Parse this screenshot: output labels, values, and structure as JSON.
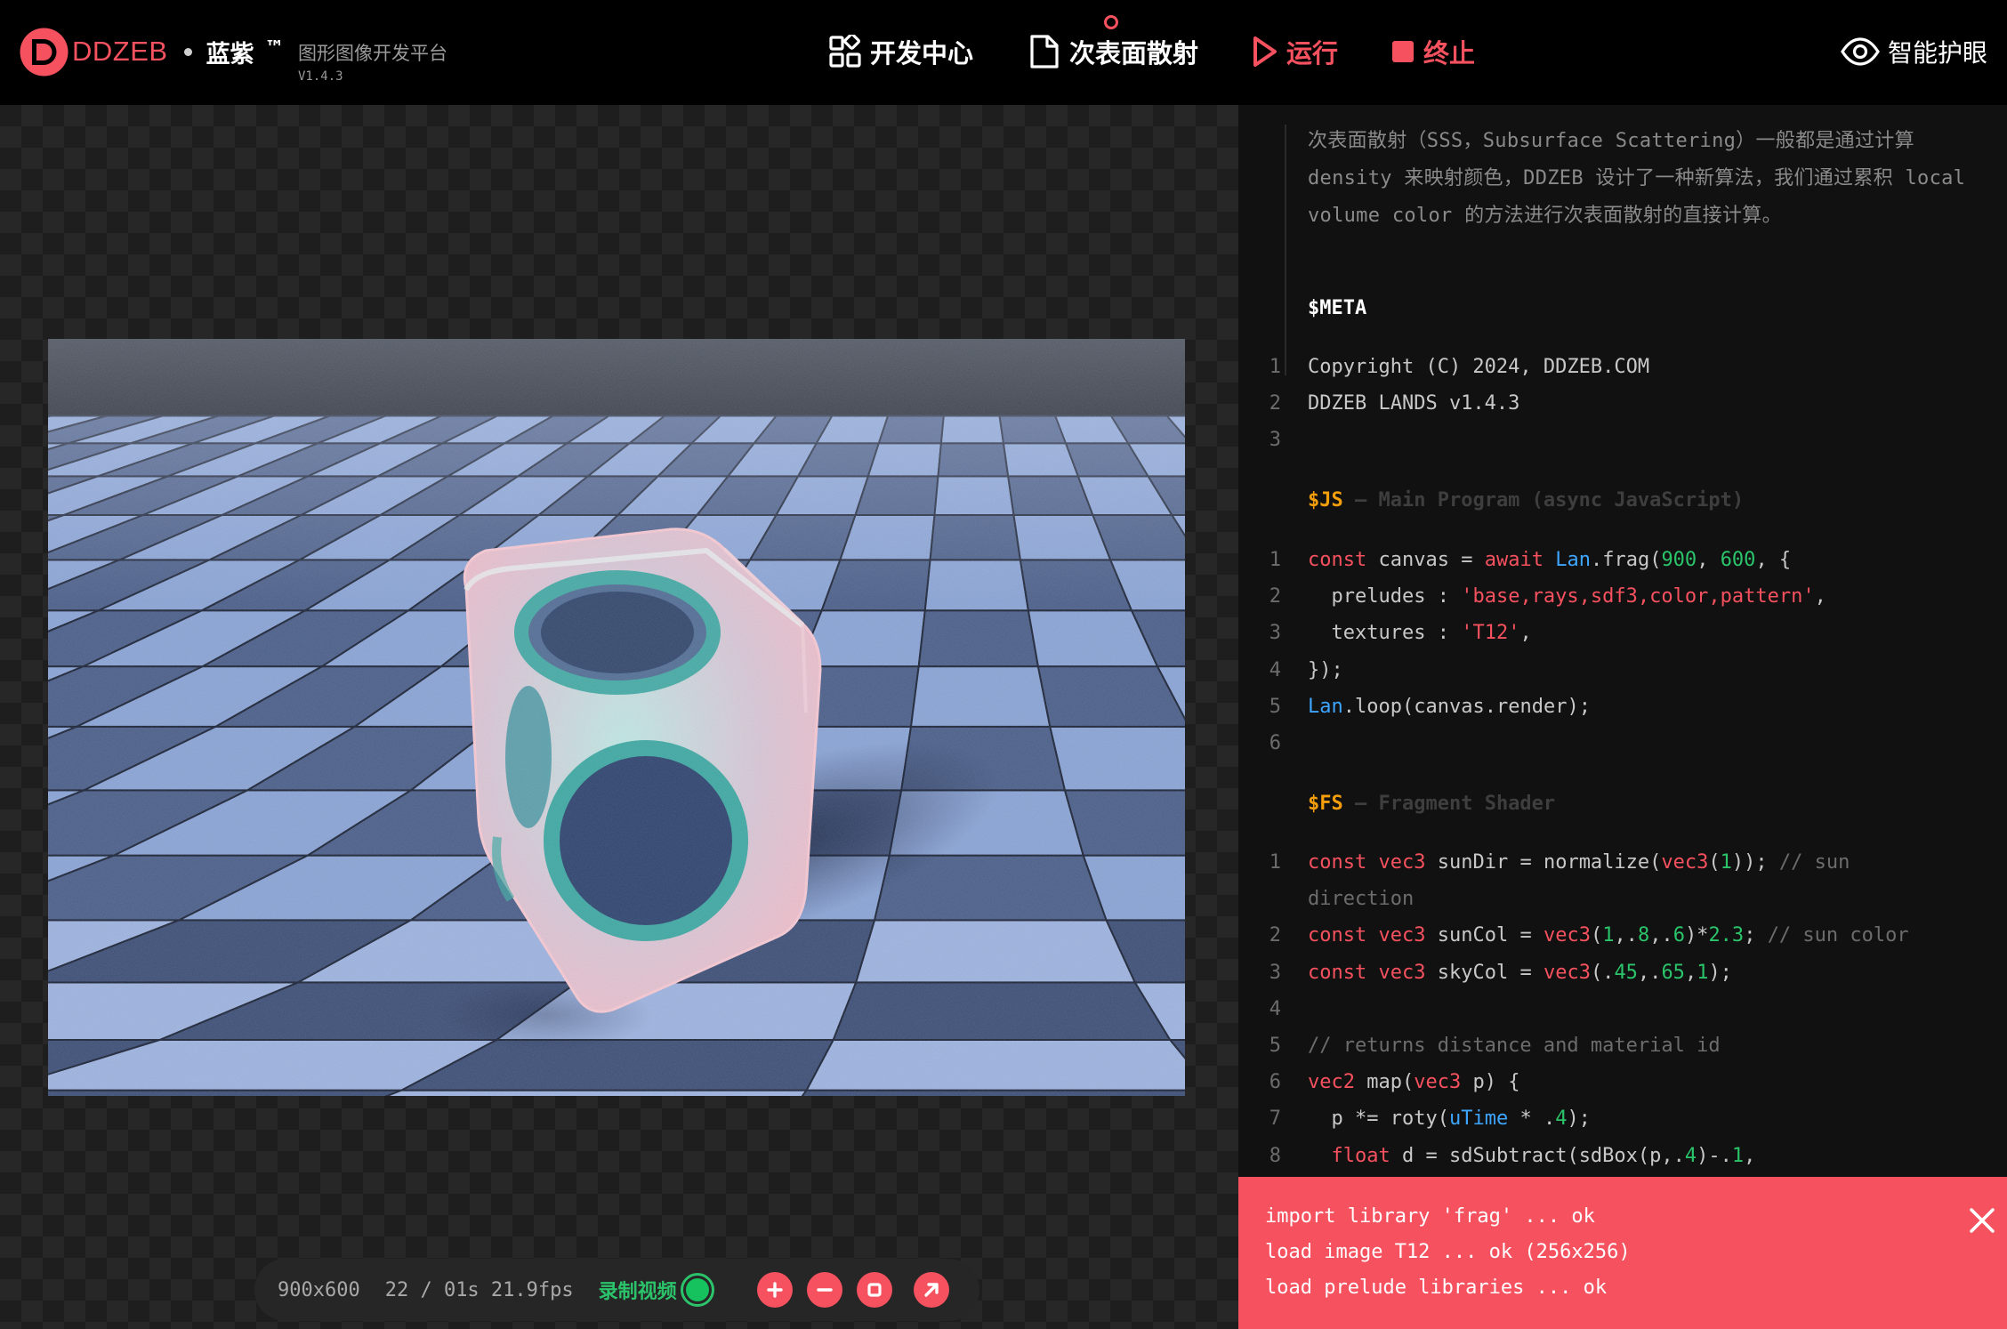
{
  "brand": {
    "name": "DDZEB",
    "cn_name": "蓝紫",
    "tm": "™",
    "subtitle": "图形图像开发平台",
    "version": "V1.4.3"
  },
  "nav": {
    "dev_center": "开发中心",
    "file_name": "次表面散射",
    "run": "运行",
    "stop": "终止",
    "eye_care": "智能护眼"
  },
  "colors": {
    "accent": "#f5515f",
    "green": "#2bc46b",
    "code_keyword": "#f5515f",
    "code_builtin": "#3ea6ff",
    "code_number": "#2bc46b",
    "section_tag": "#f59e0b"
  },
  "intro": {
    "lines": [
      "次表面散射（SSS，Subsurface Scattering）一般都是通过计算",
      "density 来映射颜色，DDZEB 设计了一种新算法，我们通过累积 local",
      "volume color 的方法进行次表面散射的直接计算。"
    ]
  },
  "meta": {
    "title": "$META",
    "lines": [
      "Copyright (C) 2024, DDZEB.COM",
      "DDZEB LANDS v1.4.3",
      ""
    ]
  },
  "js": {
    "tag": "$JS",
    "desc": "— Main Program (async JavaScript)",
    "lines": [
      "const canvas = await Lan.frag(900, 600, {",
      "  preludes : 'base,rays,sdf3,color,pattern',",
      "  textures : 'T12',",
      "});",
      "Lan.loop(canvas.render);",
      ""
    ]
  },
  "fs": {
    "tag": "$FS",
    "desc": "— Fragment Shader",
    "lines": [
      "const vec3 sunDir = normalize(vec3(1)); // sun",
      "direction",
      "const vec3 sunCol = vec3(1,.8,.6)*2.3; // sun color",
      "const vec3 skyCol = vec3(.45,.65,1);",
      "",
      "// returns distance and material id",
      "vec2 map(vec3 p) {",
      "  p *= roty(uTime * .4);",
      "  float d = sdSubtract(sdBox(p,.4)-.1,"
    ],
    "line_numbers": [
      "1",
      "",
      "2",
      "3",
      "4",
      "5",
      "6",
      "7",
      "8"
    ]
  },
  "status": {
    "resolution": "900x600",
    "frame": "22 / 01s 21.9fps",
    "record_label": "录制视频"
  },
  "console": {
    "lines": [
      "import library 'frag' ... ok",
      "load image T12 ... ok (256x256)",
      "load prelude libraries ... ok"
    ]
  },
  "icons": {
    "dev_center": "grid-icon",
    "file": "file-icon",
    "run": "play-icon",
    "stop": "stop-icon",
    "eye_care": "eye-icon",
    "close": "close-icon"
  }
}
